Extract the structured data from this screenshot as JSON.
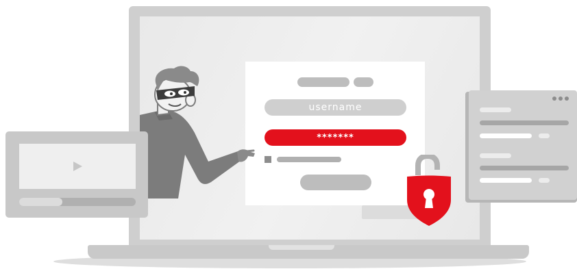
{
  "login_form": {
    "username_placeholder": "username",
    "password_mask": "*******"
  },
  "video_player": {
    "progress": 0.37
  },
  "padlock": {
    "state": "unlocked"
  },
  "colors": {
    "accent": "#e3111c",
    "laptop": "#cfcfcf",
    "screen": "#ececec",
    "card": "#ffffff",
    "placeholder_bar": "#bdbdbd",
    "figure": "#7a7a7a"
  },
  "icons": {
    "play": "play-icon",
    "lock": "unlocked-padlock-icon",
    "keyhole": "keyhole-icon",
    "window_dots": "window-controls-icon"
  }
}
